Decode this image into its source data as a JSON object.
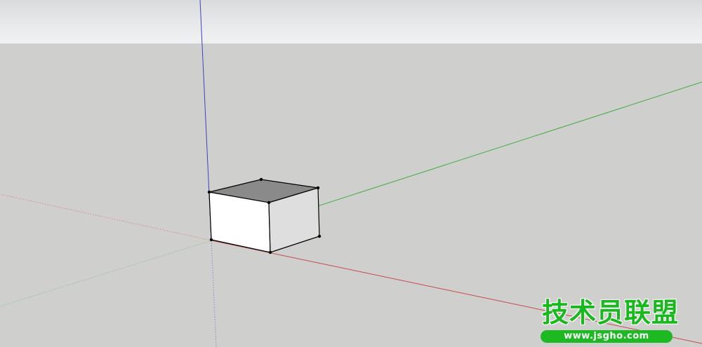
{
  "viewport": {
    "sky_color": "#e8e9eb",
    "ground_color": "#cfcfcd"
  },
  "axes": {
    "red_color": "#c94a4a",
    "green_color": "#3fae3f",
    "blue_color": "#4040c8"
  },
  "model": {
    "type": "box",
    "top_face_color": "#8a8a8a",
    "front_face_color": "#ffffff",
    "side_face_color": "#dedede",
    "edge_color": "#000000"
  },
  "watermark": {
    "title": "技术员联盟",
    "url": "www.jsgho.com",
    "color": "#1db923"
  }
}
